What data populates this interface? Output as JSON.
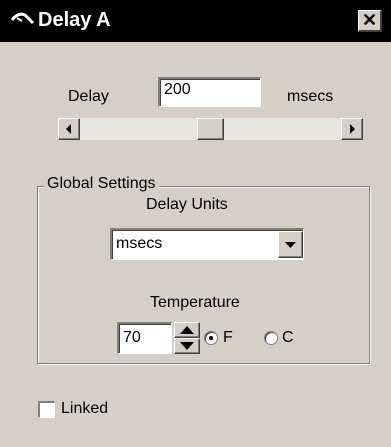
{
  "window": {
    "title": "Delay A"
  },
  "delay": {
    "label": "Delay",
    "value": "200",
    "units": "msecs",
    "slider_level": 0.5
  },
  "global": {
    "legend": "Global Settings",
    "delay_units_label": "Delay Units",
    "delay_units_value": "msecs",
    "temperature_label": "Temperature",
    "temperature_value": "70",
    "radio_f_label": "F",
    "radio_c_label": "C",
    "selected_unit": "F"
  },
  "linked": {
    "label": "Linked",
    "checked": false
  }
}
